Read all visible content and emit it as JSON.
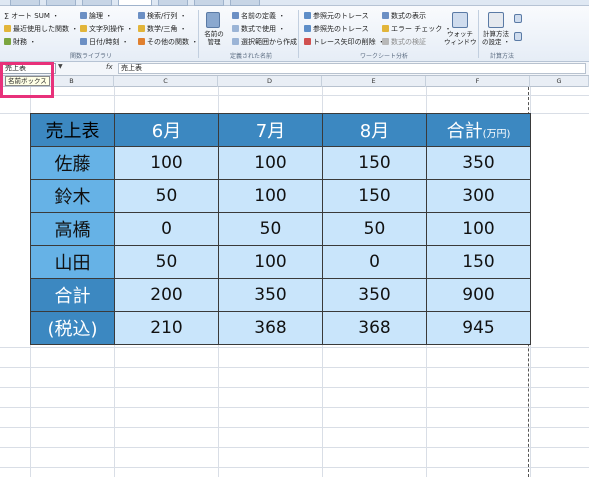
{
  "ribbon": {
    "groups": {
      "function_library": {
        "label": "関数ライブラリ",
        "items": [
          "オート SUM ・",
          "最近使用した関数 ・",
          "財務 ・",
          "論理 ・",
          "文字列操作 ・",
          "日付/時刻 ・",
          "検索/行列 ・",
          "数学/三角 ・",
          "その他の関数 ・"
        ]
      },
      "defined_names": {
        "label": "定義された名前",
        "manager_label": "名前の\n管理",
        "items": [
          "名前の定義 ・",
          "数式で使用 ・",
          "選択範囲から作成"
        ]
      },
      "formula_auditing": {
        "label": "ワークシート分析",
        "items": [
          "参照元のトレース",
          "参照先のトレース",
          "トレース矢印の削除 ・",
          "数式の表示",
          "エラー チェック ・",
          "数式の検証"
        ],
        "watch_label": "ウォッチ\nウィンドウ"
      },
      "calculation": {
        "label": "計算方法",
        "options_label": "計算方法\nの設定 ・"
      }
    }
  },
  "formula_bar": {
    "name_box_value": "売上表",
    "name_box_tooltip": "名前ボックス",
    "fx": "fx",
    "formula_value": "売上表"
  },
  "columns": [
    "B",
    "C",
    "D",
    "E",
    "F",
    "G"
  ],
  "table": {
    "corner": "売上表",
    "headers": [
      "6月",
      "7月",
      "8月"
    ],
    "total_header": "合計",
    "total_unit": "(万円)",
    "rows": [
      {
        "label": "佐藤",
        "values": [
          "100",
          "100",
          "150",
          "350"
        ]
      },
      {
        "label": "鈴木",
        "values": [
          "50",
          "100",
          "150",
          "300"
        ]
      },
      {
        "label": "高橋",
        "values": [
          "0",
          "50",
          "50",
          "100"
        ]
      },
      {
        "label": "山田",
        "values": [
          "50",
          "100",
          "0",
          "150"
        ]
      },
      {
        "label": "合計",
        "values": [
          "200",
          "350",
          "350",
          "900"
        ]
      },
      {
        "label": "(税込)",
        "values": [
          "210",
          "368",
          "368",
          "945"
        ]
      }
    ]
  },
  "colors": {
    "header_dark": "#3c88c1",
    "row_header": "#66b2e6",
    "value_cell": "#c9e5fb",
    "highlight": "#e8317a"
  }
}
